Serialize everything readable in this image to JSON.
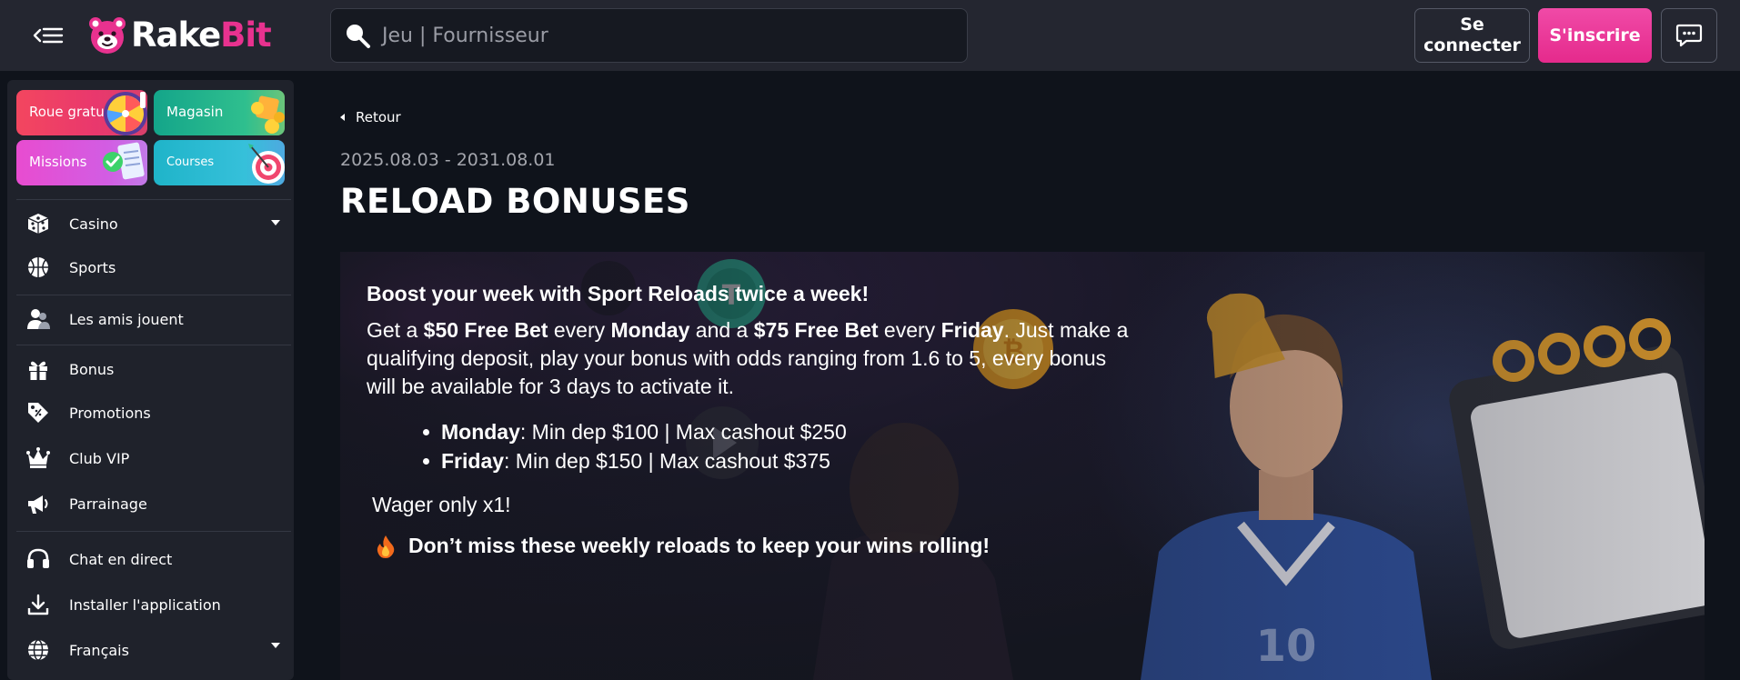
{
  "header": {
    "brand_part1": "Rake",
    "brand_part2": "Bit",
    "search_placeholder": "Jeu | Fournisseur",
    "login_label": "Se connecter",
    "signup_label": "S'inscrire",
    "icons": [
      "menu-collapse-icon",
      "search-icon",
      "chat-icon"
    ]
  },
  "sidebar": {
    "tiles": [
      {
        "label": "Roue gratuite",
        "icon": "wheel-icon"
      },
      {
        "label": "Magasin",
        "icon": "coins-icon"
      },
      {
        "label": "Missions",
        "icon": "checklist-icon"
      },
      {
        "label": "Courses",
        "icon": "target-icon"
      }
    ],
    "items": [
      {
        "label": "Casino",
        "icon": "dice-icon",
        "expandable": true
      },
      {
        "label": "Sports",
        "icon": "basketball-icon"
      },
      {
        "label": "Les amis jouent",
        "icon": "friends-icon"
      },
      {
        "label": "Bonus",
        "icon": "gift-icon"
      },
      {
        "label": "Promotions",
        "icon": "promo-tag-icon"
      },
      {
        "label": "Club VIP",
        "icon": "crown-icon"
      },
      {
        "label": "Parrainage",
        "icon": "megaphone-icon"
      },
      {
        "label": "Chat en direct",
        "icon": "headset-icon"
      },
      {
        "label": "Installer l'application",
        "icon": "download-icon"
      },
      {
        "label": "Français",
        "icon": "globe-icon",
        "expandable": true
      }
    ]
  },
  "main": {
    "back_label": "Retour",
    "dates": "2025.08.03 - 2031.08.01",
    "title": "RELOAD BONUSES",
    "promo": {
      "headline": "Boost your week with Sport Reloads twice a week!",
      "body_parts": {
        "p1": "Get a ",
        "b1": "$50 Free Bet",
        "p2": " every ",
        "b2": "Monday",
        "p3": " and a ",
        "b3": "$75 Free Bet",
        "p4": " every ",
        "b4": "Friday",
        "p5": ". Just make a qualifying deposit, play your bonus with odds ranging from 1.6 to 5, every bonus will be available for 3 days to activate it."
      },
      "list": [
        {
          "day": "Monday",
          "detail": ": Min dep $100 | Max cashout $250"
        },
        {
          "day": "Friday",
          "detail": ": Min dep $150 | Max cashout $375"
        }
      ],
      "wager": "Wager only x1!",
      "closing": "Don’t miss these weekly reloads to keep your wins rolling!"
    },
    "accent_colors": {
      "brand_pink": "#e8328f",
      "signup": "#ec3c9c"
    }
  }
}
